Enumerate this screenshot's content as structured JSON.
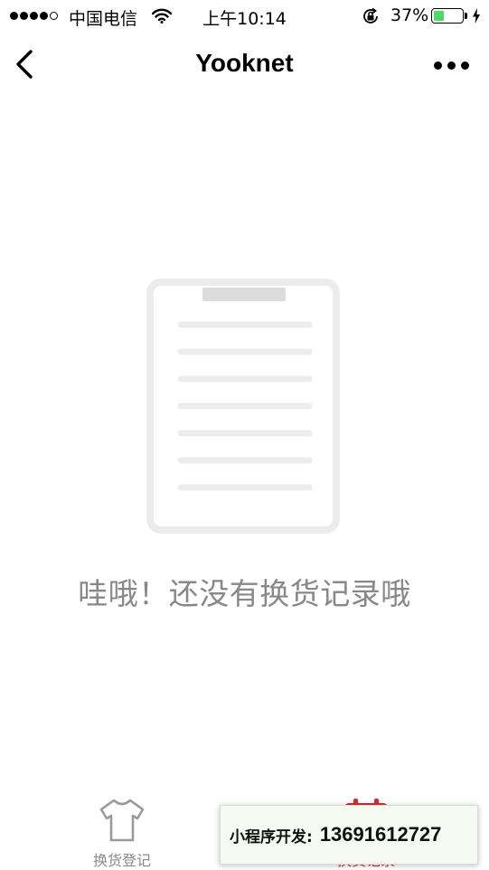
{
  "status_bar": {
    "carrier": "中国电信",
    "time": "上午10:14",
    "battery_percent_text": "37%",
    "battery_level": 0.37,
    "signal_bars_filled": 4,
    "signal_bars_total": 5
  },
  "nav": {
    "title": "Yooknet",
    "back_icon": "chevron-left-icon",
    "more_icon": "more-dots-icon"
  },
  "empty_state": {
    "illustration_icon": "clipboard-document-icon",
    "message": "哇哦！还没有换货记录哦"
  },
  "tabs": [
    {
      "label": "换货登记",
      "icon": "tshirt-icon",
      "active": false
    },
    {
      "label": "换货记录",
      "icon": "record-icon",
      "active": true
    }
  ],
  "promo_banner": {
    "label": "小程序开发:",
    "phone": "13691612727"
  },
  "colors": {
    "accent": "#e0262f",
    "battery": "#4cd964",
    "muted_text": "#888888",
    "illustration": "#ececec"
  }
}
